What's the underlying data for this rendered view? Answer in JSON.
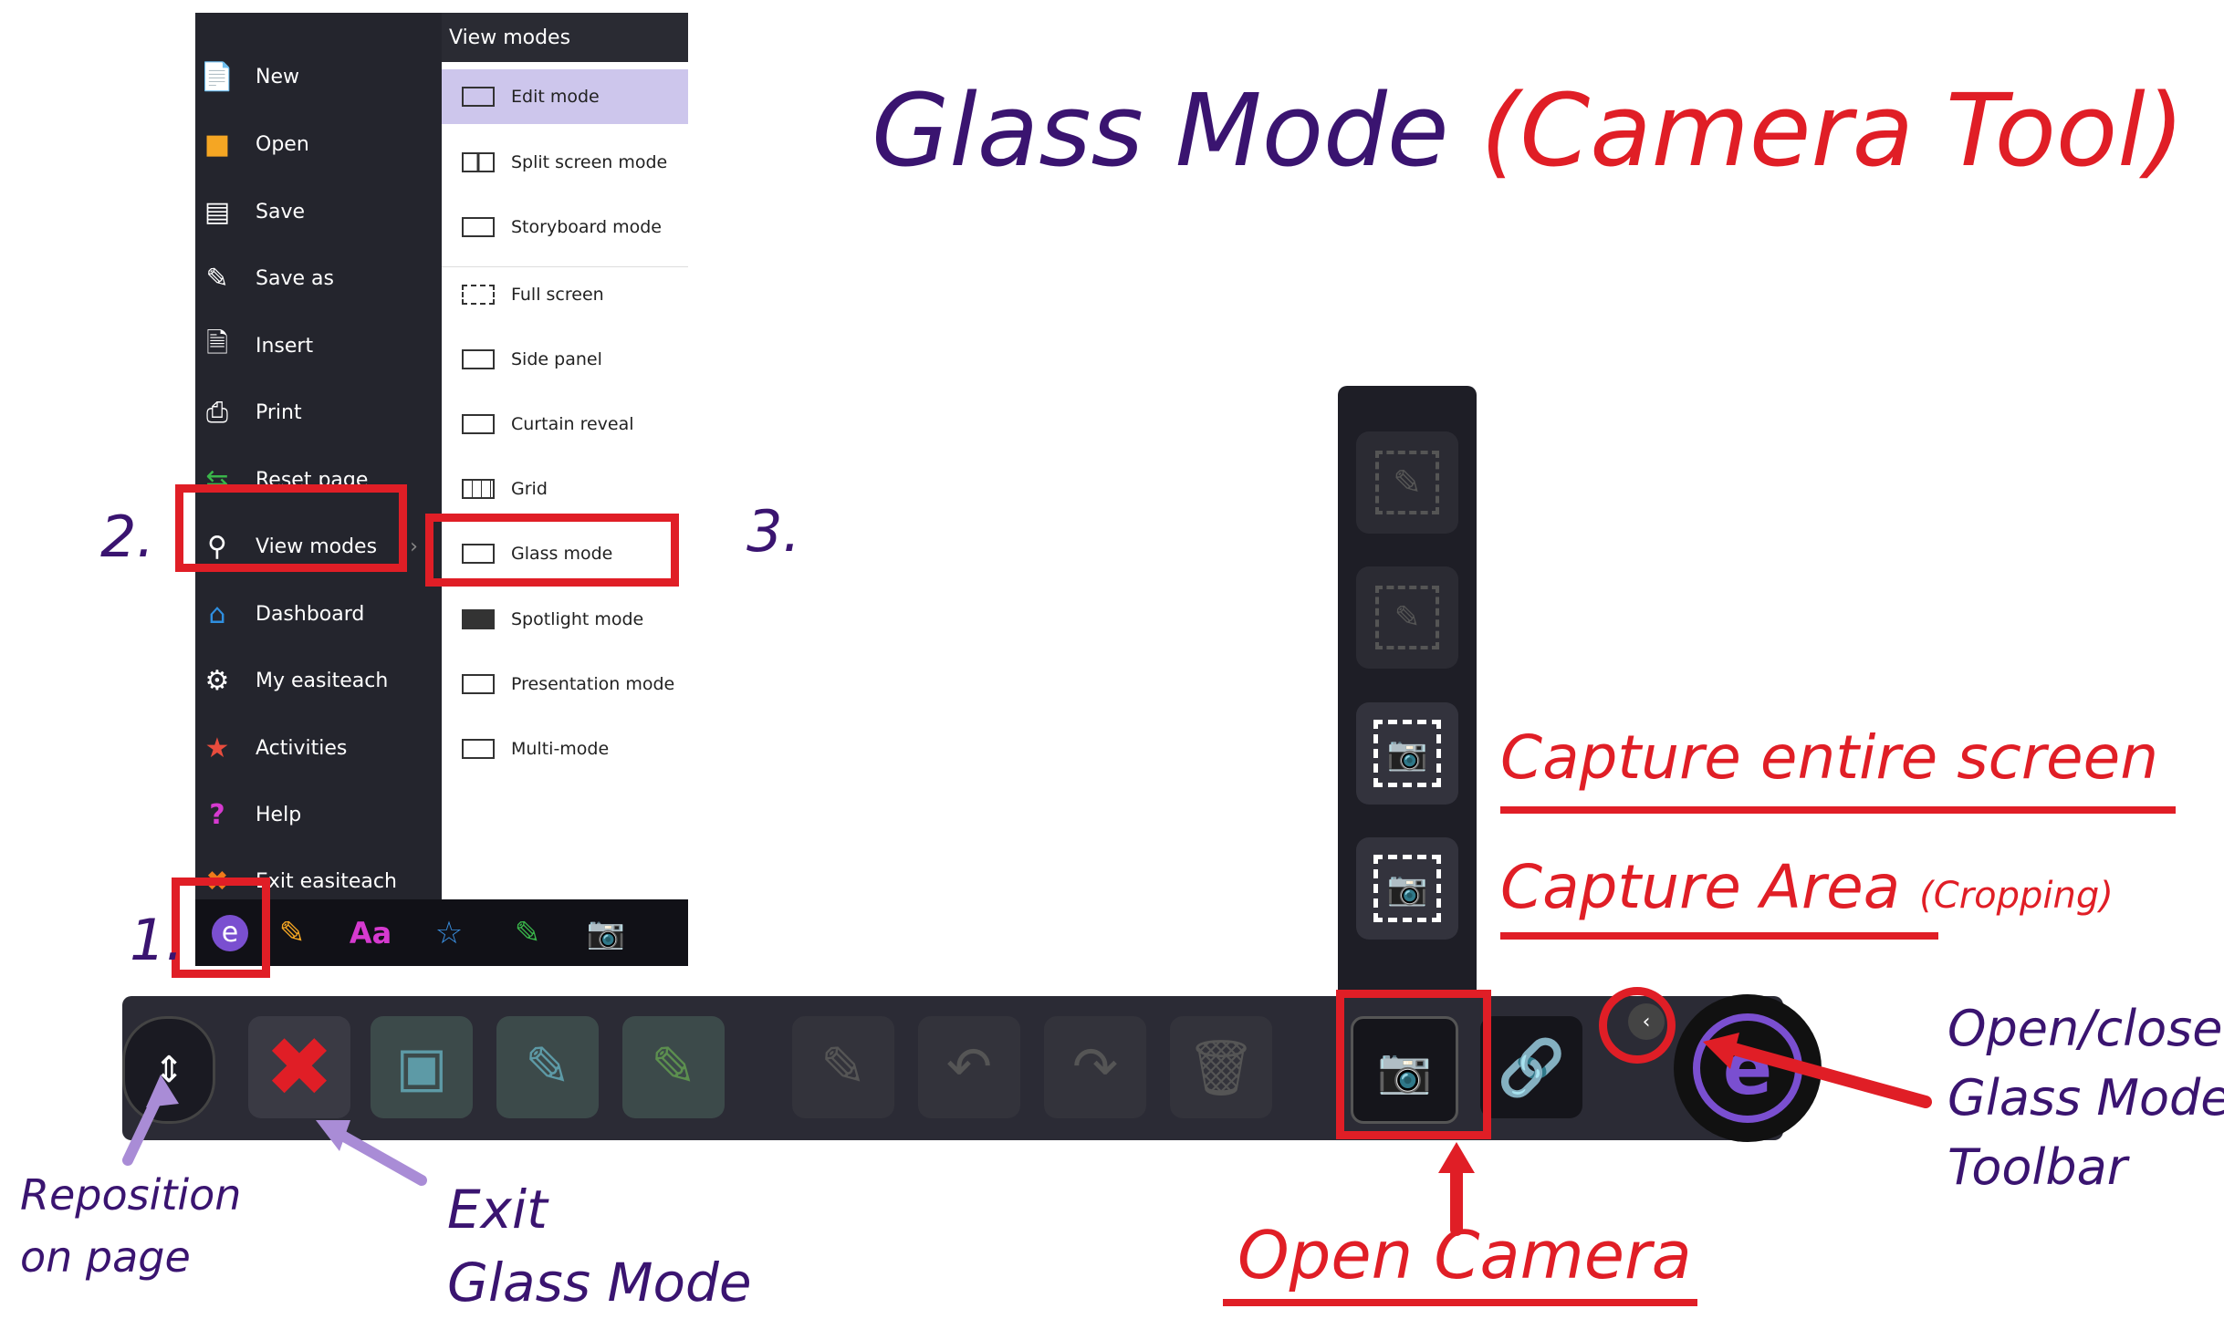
{
  "title": {
    "part1": "Glass Mode",
    "part2": "(Camera Tool)"
  },
  "menu": {
    "items": [
      {
        "label": "New",
        "icon": "new-file-icon"
      },
      {
        "label": "Open",
        "icon": "folder-icon"
      },
      {
        "label": "Save",
        "icon": "save-icon"
      },
      {
        "label": "Save as",
        "icon": "save-as-icon"
      },
      {
        "label": "Insert",
        "icon": "insert-icon"
      },
      {
        "label": "Print",
        "icon": "printer-icon"
      },
      {
        "label": "Reset page",
        "icon": "reset-icon"
      },
      {
        "label": "View modes",
        "icon": "magnifier-icon"
      },
      {
        "label": "Dashboard",
        "icon": "home-icon"
      },
      {
        "label": "My easiteach",
        "icon": "gear-icon"
      },
      {
        "label": "Activities",
        "icon": "activities-icon"
      },
      {
        "label": "Help",
        "icon": "help-icon"
      },
      {
        "label": "Exit easiteach",
        "icon": "exit-icon"
      }
    ],
    "submenu_title": "View modes",
    "submenu": [
      {
        "label": "Edit mode"
      },
      {
        "label": "Split screen mode"
      },
      {
        "label": "Storyboard mode"
      },
      {
        "label": "Full screen"
      },
      {
        "label": "Side panel"
      },
      {
        "label": "Curtain reveal"
      },
      {
        "label": "Grid"
      },
      {
        "label": "Glass mode"
      },
      {
        "label": "Spotlight mode"
      },
      {
        "label": "Presentation mode"
      },
      {
        "label": "Multi-mode"
      }
    ]
  },
  "steps": {
    "s1": "1.",
    "s2": "2.",
    "s3": "3."
  },
  "annotations": {
    "capture_entire": "Capture entire screen",
    "capture_area": "Capture Area",
    "cropping": "(Cropping)",
    "open_close_1": "Open/close",
    "open_close_2": "Glass Mode",
    "open_close_3": "Toolbar",
    "reposition_1": "Reposition",
    "reposition_2": "on page",
    "exit_1": "Exit",
    "exit_2": "Glass Mode",
    "open_camera": "Open Camera"
  },
  "colors": {
    "accent_red": "#e01e26",
    "annotation_purple": "#3a1470",
    "arrow_lilac": "#a98cd6",
    "submenu_highlight": "#cdc6ec"
  }
}
